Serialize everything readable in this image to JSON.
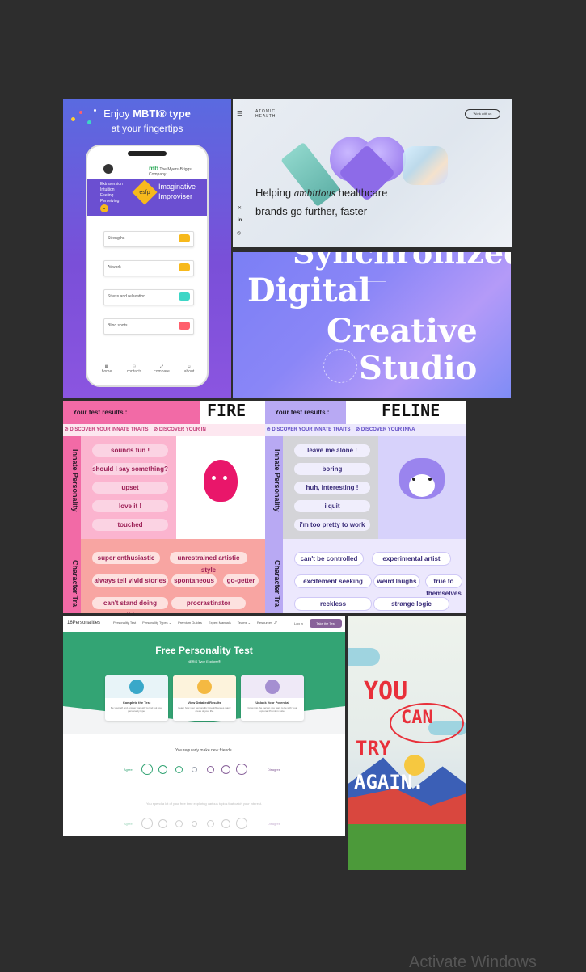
{
  "mbti": {
    "headline_pre": "Enjoy ",
    "headline_bold": "MBTI® type",
    "headline_line2": "at your fingertips",
    "brand": "The Myers-Briggs Company",
    "traits": [
      "Extraversion",
      "Intuition",
      "Feeling",
      "Perceiving"
    ],
    "type_code": "esfp",
    "type_name_1": "Imaginative",
    "type_name_2": "Improviser",
    "rows": [
      "Strengths",
      "At work",
      "Stress and relaxation",
      "Blind spots"
    ],
    "nav": [
      "home",
      "contacts",
      "compare",
      "about"
    ]
  },
  "atomic": {
    "logo_1": "ATOMIC",
    "logo_2": "HEALTH",
    "cta": "Work with us",
    "headline_1a": "Helping ",
    "headline_1b": "ambitious",
    "headline_1c": " healthcare",
    "headline_2": "brands go further, faster",
    "social": [
      "✕",
      "in",
      "◎"
    ]
  },
  "studio": {
    "top": "Synchronized",
    "line1": "Digital",
    "line2": "Creative",
    "line3": "Studio"
  },
  "fire": {
    "header": "Your test results :",
    "result": "FIRE",
    "strip": "DISCOVER YOUR INNATE TRAITS",
    "strip2": "DISCOVER YOUR IN",
    "innate_label": "Innate Personality",
    "innate": [
      "sounds fun !",
      "should I say something?",
      "upset",
      "love it !",
      "touched"
    ],
    "char_label": "Character Tra",
    "character": [
      "super enthusiastic",
      "unrestrained artistic style",
      "always tell vivid stories",
      "spontaneous",
      "go-getter",
      "can't stand doing nothing",
      "procrastinator"
    ]
  },
  "feline": {
    "header": "Your test results :",
    "result": "FELINE",
    "strip": "DISCOVER YOUR INNATE TRAITS",
    "strip2": "DISCOVER YOUR INNA",
    "innate_label": "Innate Personality",
    "innate": [
      "leave me alone !",
      "boring",
      "huh, interesting !",
      "i quit",
      "i'm too pretty to work"
    ],
    "char_label": "Character Tra",
    "character": [
      "can't be controlled",
      "experimental artist",
      "excitement seeking",
      "weird laughs",
      "true to themselves",
      "reckless",
      "strange logic"
    ]
  },
  "sixteen": {
    "logo": "16Personalities",
    "nav": [
      "Personality Test",
      "Personality Types ⌄",
      "Premium Guides",
      "Expert Manuals",
      "Teams ⌄",
      "Resources ⌄"
    ],
    "login": "Log in",
    "cta": "Take the Test",
    "title": "Free Personality Test",
    "subtitle": "NERIS Type Explorer®",
    "cards": [
      {
        "title": "Complete the Test",
        "text": "Be yourself and answer honestly to find out your personality type."
      },
      {
        "title": "View Detailed Results",
        "text": "Learn how your personality type influences many areas of your life."
      },
      {
        "title": "Unlock Your Potential",
        "text": "Grow into the person you want to be with your optional Premium suite."
      }
    ],
    "q1": "You regularly make new friends.",
    "q2": "You spend a lot of your free time exploring various topics that catch your interest.",
    "agree": "Agree",
    "disagree": "Disagree"
  },
  "poster": {
    "w1": "YOU",
    "w2": "CAN",
    "w3": "TRY",
    "w4": "AGAIN."
  },
  "watermark": "Activate Windows",
  "colors": {
    "bg": "#2d2d2d",
    "mbti_purple": "#6b4fd1",
    "fire_pink": "#f36ba4",
    "feline_lavender": "#b6a8f2",
    "sixteen_green": "#33a474"
  }
}
